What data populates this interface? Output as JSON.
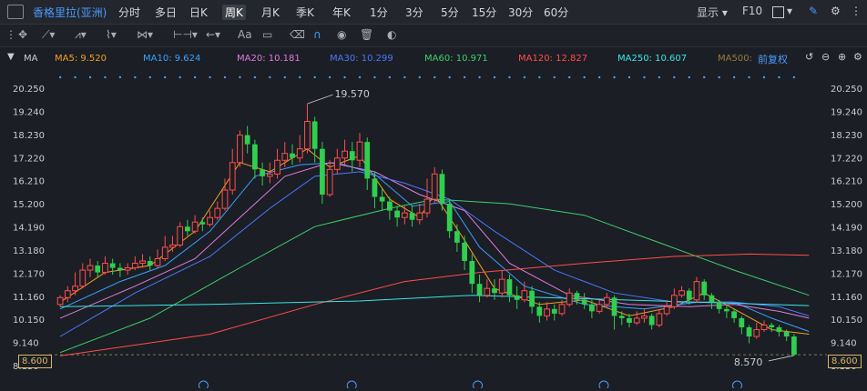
{
  "header": {
    "stock_name": "香格里拉(亚洲)",
    "timeframes": [
      "分时",
      "多日",
      "日K",
      "周K",
      "月K",
      "季K",
      "年K",
      "1分",
      "3分",
      "5分",
      "15分",
      "30分",
      "60分"
    ],
    "active_timeframe": "周K",
    "display_label": "显示",
    "f10_label": "F10"
  },
  "toolbar": {
    "text_tool": "Aa"
  },
  "indicator_bar": {
    "name": "MA",
    "adjust_label": "前复权",
    "items": [
      {
        "label": "MA5: 9.520",
        "color": "#f0a020"
      },
      {
        "label": "MA10: 9.624",
        "color": "#3aa0ff"
      },
      {
        "label": "MA20: 10.181",
        "color": "#e07be0"
      },
      {
        "label": "MA30: 10.299",
        "color": "#4a78ff"
      },
      {
        "label": "MA60: 10.971",
        "color": "#3ecf6e"
      },
      {
        "label": "MA120: 12.827",
        "color": "#ff4d4d"
      },
      {
        "label": "MA250: 10.607",
        "color": "#39e6ea"
      },
      {
        "label": "MA500:",
        "color": "#9a7a3a"
      }
    ]
  },
  "price_axis": {
    "labels": [
      "20.250",
      "19.240",
      "18.230",
      "17.220",
      "16.210",
      "15.200",
      "14.190",
      "13.180",
      "12.170",
      "11.160",
      "10.150",
      "9.140",
      "8.130"
    ],
    "current_price": "8.600",
    "max_label": "19.570",
    "min_label": "8.570"
  },
  "chart_data": {
    "type": "candlestick",
    "ylim": [
      8.13,
      20.25
    ],
    "max_price": 19.57,
    "min_price": 8.57,
    "last_price": 8.6,
    "candles": [
      [
        10.8,
        11.1,
        10.7,
        11.2
      ],
      [
        11.1,
        11.4,
        10.9,
        11.6
      ],
      [
        11.4,
        11.6,
        11.2,
        12.2
      ],
      [
        11.6,
        12.3,
        11.5,
        12.6
      ],
      [
        12.3,
        12.5,
        12.0,
        12.8
      ],
      [
        12.5,
        12.2,
        12.0,
        12.7
      ],
      [
        12.2,
        12.6,
        12.1,
        12.9
      ],
      [
        12.6,
        12.4,
        12.1,
        12.8
      ],
      [
        12.4,
        12.3,
        12.0,
        12.6
      ],
      [
        12.3,
        12.4,
        12.1,
        12.6
      ],
      [
        12.4,
        12.6,
        12.3,
        12.9
      ],
      [
        12.6,
        12.7,
        12.4,
        13.0
      ],
      [
        12.7,
        12.5,
        12.3,
        12.9
      ],
      [
        12.5,
        12.8,
        12.4,
        13.2
      ],
      [
        12.8,
        13.3,
        12.7,
        13.8
      ],
      [
        13.3,
        13.4,
        13.1,
        13.8
      ],
      [
        13.4,
        14.2,
        13.3,
        14.4
      ],
      [
        14.2,
        14.0,
        13.8,
        14.5
      ],
      [
        14.0,
        14.4,
        13.9,
        14.7
      ],
      [
        14.4,
        14.3,
        14.0,
        14.6
      ],
      [
        14.3,
        14.6,
        14.2,
        14.9
      ],
      [
        14.6,
        15.0,
        14.5,
        15.3
      ],
      [
        15.0,
        15.8,
        14.9,
        16.3
      ],
      [
        15.8,
        17.0,
        15.6,
        17.6
      ],
      [
        17.0,
        18.2,
        16.8,
        18.4
      ],
      [
        18.2,
        17.8,
        17.4,
        18.6
      ],
      [
        17.8,
        16.7,
        16.3,
        18.0
      ],
      [
        16.7,
        16.4,
        16.0,
        17.0
      ],
      [
        16.4,
        16.5,
        16.1,
        17.0
      ],
      [
        16.5,
        17.1,
        16.3,
        17.6
      ],
      [
        17.1,
        17.4,
        16.8,
        17.9
      ],
      [
        17.4,
        17.2,
        16.9,
        17.8
      ],
      [
        17.2,
        17.6,
        17.0,
        18.2
      ],
      [
        17.6,
        18.8,
        17.4,
        19.57
      ],
      [
        18.8,
        17.6,
        17.0,
        19.0
      ],
      [
        17.6,
        15.6,
        15.2,
        17.9
      ],
      [
        15.6,
        16.7,
        15.5,
        17.1
      ],
      [
        16.7,
        17.2,
        16.5,
        17.6
      ],
      [
        17.2,
        17.5,
        16.9,
        18.0
      ],
      [
        17.5,
        17.1,
        16.6,
        17.9
      ],
      [
        17.1,
        17.9,
        16.8,
        18.3
      ],
      [
        17.9,
        16.3,
        15.8,
        18.1
      ],
      [
        16.3,
        15.5,
        15.0,
        16.6
      ],
      [
        15.5,
        15.3,
        14.9,
        15.9
      ],
      [
        15.3,
        14.9,
        14.5,
        15.5
      ],
      [
        14.9,
        14.6,
        14.2,
        15.1
      ],
      [
        14.6,
        14.8,
        14.3,
        15.1
      ],
      [
        14.8,
        14.5,
        14.2,
        15.1
      ],
      [
        14.5,
        14.8,
        14.3,
        15.2
      ],
      [
        14.8,
        15.4,
        14.6,
        16.3
      ],
      [
        15.4,
        16.5,
        15.2,
        16.8
      ],
      [
        16.5,
        15.2,
        14.9,
        16.7
      ],
      [
        15.2,
        14.0,
        13.7,
        15.4
      ],
      [
        14.0,
        13.5,
        13.1,
        14.3
      ],
      [
        13.5,
        12.7,
        12.3,
        13.8
      ],
      [
        12.7,
        11.7,
        11.3,
        13.0
      ],
      [
        11.7,
        11.2,
        10.9,
        12.1
      ],
      [
        11.2,
        11.5,
        11.1,
        11.9
      ],
      [
        11.5,
        11.3,
        11.0,
        11.9
      ],
      [
        11.3,
        11.9,
        11.1,
        12.3
      ],
      [
        11.9,
        11.2,
        10.9,
        12.1
      ],
      [
        11.2,
        11.0,
        10.6,
        11.6
      ],
      [
        11.0,
        11.4,
        10.9,
        11.8
      ],
      [
        11.4,
        10.7,
        10.4,
        11.6
      ],
      [
        10.7,
        10.3,
        10.0,
        10.9
      ],
      [
        10.3,
        10.6,
        10.1,
        10.9
      ],
      [
        10.6,
        10.4,
        10.1,
        10.8
      ],
      [
        10.4,
        10.8,
        10.3,
        11.0
      ],
      [
        10.8,
        11.3,
        10.7,
        11.5
      ],
      [
        11.3,
        11.0,
        10.8,
        11.4
      ],
      [
        11.0,
        10.8,
        10.6,
        11.3
      ],
      [
        10.8,
        10.5,
        10.2,
        11.0
      ],
      [
        10.5,
        10.8,
        10.4,
        11.0
      ],
      [
        10.8,
        11.1,
        10.7,
        11.3
      ],
      [
        11.1,
        10.3,
        9.7,
        11.2
      ],
      [
        10.3,
        10.2,
        9.9,
        10.5
      ],
      [
        10.2,
        10.0,
        9.8,
        10.4
      ],
      [
        10.0,
        10.2,
        9.9,
        10.5
      ],
      [
        10.2,
        10.3,
        10.0,
        10.6
      ],
      [
        10.3,
        9.9,
        9.7,
        10.4
      ],
      [
        9.9,
        10.4,
        9.8,
        10.6
      ],
      [
        10.4,
        10.7,
        10.3,
        11.0
      ],
      [
        10.7,
        11.2,
        10.6,
        11.5
      ],
      [
        11.2,
        11.4,
        11.1,
        11.6
      ],
      [
        11.4,
        11.0,
        10.8,
        11.5
      ],
      [
        11.0,
        11.8,
        10.9,
        12.0
      ],
      [
        11.8,
        11.2,
        11.0,
        11.9
      ],
      [
        11.2,
        10.9,
        10.6,
        11.3
      ],
      [
        10.9,
        10.6,
        10.4,
        11.0
      ],
      [
        10.6,
        10.5,
        10.2,
        10.8
      ],
      [
        10.5,
        10.2,
        10.0,
        10.6
      ],
      [
        10.2,
        9.8,
        9.5,
        10.3
      ],
      [
        9.8,
        9.4,
        9.1,
        9.9
      ],
      [
        9.4,
        9.7,
        9.3,
        10.0
      ],
      [
        9.7,
        9.9,
        9.6,
        10.1
      ],
      [
        9.9,
        9.8,
        9.6,
        10.0
      ],
      [
        9.8,
        9.6,
        9.4,
        9.9
      ],
      [
        9.6,
        9.4,
        9.2,
        9.7
      ],
      [
        9.4,
        8.6,
        8.57,
        9.5
      ]
    ],
    "ma_series": [
      {
        "name": "MA5",
        "color": "#f0a020",
        "values": [
          [
            0,
            10.9
          ],
          [
            6,
            12.2
          ],
          [
            12,
            12.5
          ],
          [
            18,
            14.0
          ],
          [
            24,
            17.0
          ],
          [
            28,
            16.6
          ],
          [
            33,
            17.6
          ],
          [
            36,
            16.8
          ],
          [
            40,
            17.3
          ],
          [
            44,
            15.4
          ],
          [
            48,
            14.6
          ],
          [
            50,
            15.6
          ],
          [
            54,
            13.6
          ],
          [
            58,
            11.5
          ],
          [
            64,
            10.8
          ],
          [
            70,
            11.0
          ],
          [
            76,
            10.3
          ],
          [
            82,
            10.7
          ],
          [
            86,
            11.3
          ],
          [
            90,
            10.6
          ],
          [
            95,
            9.7
          ],
          [
            100,
            9.5
          ]
        ]
      },
      {
        "name": "MA10",
        "color": "#3aa0ff",
        "values": [
          [
            0,
            10.6
          ],
          [
            8,
            11.8
          ],
          [
            14,
            12.5
          ],
          [
            20,
            14.0
          ],
          [
            26,
            16.4
          ],
          [
            32,
            16.9
          ],
          [
            37,
            17.0
          ],
          [
            42,
            16.5
          ],
          [
            47,
            15.1
          ],
          [
            52,
            15.3
          ],
          [
            56,
            13.3
          ],
          [
            62,
            11.6
          ],
          [
            70,
            10.8
          ],
          [
            78,
            10.6
          ],
          [
            85,
            10.9
          ],
          [
            90,
            10.9
          ],
          [
            95,
            10.2
          ],
          [
            100,
            9.62
          ]
        ]
      },
      {
        "name": "MA20",
        "color": "#e07be0",
        "values": [
          [
            0,
            10.2
          ],
          [
            10,
            11.6
          ],
          [
            18,
            12.8
          ],
          [
            24,
            14.6
          ],
          [
            30,
            16.4
          ],
          [
            36,
            17.0
          ],
          [
            42,
            16.6
          ],
          [
            48,
            15.6
          ],
          [
            54,
            14.9
          ],
          [
            60,
            12.6
          ],
          [
            68,
            11.2
          ],
          [
            76,
            10.8
          ],
          [
            84,
            10.7
          ],
          [
            90,
            10.8
          ],
          [
            96,
            10.5
          ],
          [
            100,
            10.2
          ]
        ]
      },
      {
        "name": "MA30",
        "color": "#4a78ff",
        "values": [
          [
            0,
            9.4
          ],
          [
            10,
            11.3
          ],
          [
            20,
            12.9
          ],
          [
            28,
            15.0
          ],
          [
            34,
            16.4
          ],
          [
            40,
            16.6
          ],
          [
            46,
            16.1
          ],
          [
            52,
            15.4
          ],
          [
            58,
            14.0
          ],
          [
            66,
            12.3
          ],
          [
            74,
            11.3
          ],
          [
            82,
            10.9
          ],
          [
            90,
            10.9
          ],
          [
            96,
            10.7
          ],
          [
            100,
            10.3
          ]
        ]
      },
      {
        "name": "MA60",
        "color": "#3ecf6e",
        "values": [
          [
            0,
            8.7
          ],
          [
            12,
            10.2
          ],
          [
            24,
            12.4
          ],
          [
            34,
            14.2
          ],
          [
            44,
            15.0
          ],
          [
            50,
            15.4
          ],
          [
            60,
            15.2
          ],
          [
            70,
            14.7
          ],
          [
            80,
            13.5
          ],
          [
            90,
            12.3
          ],
          [
            100,
            11.2
          ]
        ]
      },
      {
        "name": "MA120",
        "color": "#ff4d4d",
        "values": [
          [
            0,
            8.55
          ],
          [
            20,
            9.5
          ],
          [
            34,
            10.8
          ],
          [
            46,
            11.8
          ],
          [
            56,
            12.2
          ],
          [
            70,
            12.6
          ],
          [
            82,
            12.9
          ],
          [
            92,
            13.0
          ],
          [
            100,
            12.95
          ]
        ]
      },
      {
        "name": "MA250",
        "color": "#39e6ea",
        "values": [
          [
            0,
            10.7
          ],
          [
            20,
            10.8
          ],
          [
            40,
            10.95
          ],
          [
            55,
            11.2
          ],
          [
            70,
            11.05
          ],
          [
            85,
            10.9
          ],
          [
            100,
            10.75
          ]
        ]
      }
    ]
  }
}
